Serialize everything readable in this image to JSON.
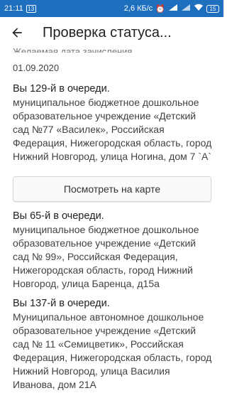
{
  "statusbar": {
    "time": "21:11",
    "notif_num": "13",
    "speed": "2,6 КБ/с",
    "battery": "15"
  },
  "appbar": {
    "title": "Проверка статуса..."
  },
  "section": {
    "label": "Желаемая дата зачисления",
    "date": "01.09.2020"
  },
  "queue_items": [
    {
      "position": "Вы 129-й в очереди.",
      "org": "муниципальное бюджетное дошкольное образовательное учреждение «Детский сад №77 «Василек», Российская Федерация, Нижегородская область, город Нижний Новгород, улица Ногина, дом 7 `А`"
    },
    {
      "position": "Вы 65-й в очереди.",
      "org": "муниципальное бюджетное дошкольное образовательное учреждение «Детский сад № 99», Российская Федерация, Нижегородская область, город Нижний Новгород, улица Баренца, д15а"
    },
    {
      "position": "Вы 137-й в очереди.",
      "org": "Муниципальное автономное дошкольное образовательное учреждение «Детский сад № 11 «Семицветик», Российская Федерация, Нижегородская область, город Нижний Новгород, улица Василия Иванова, дом 21А"
    }
  ],
  "map_button": {
    "label": "Посмотреть на карте"
  }
}
